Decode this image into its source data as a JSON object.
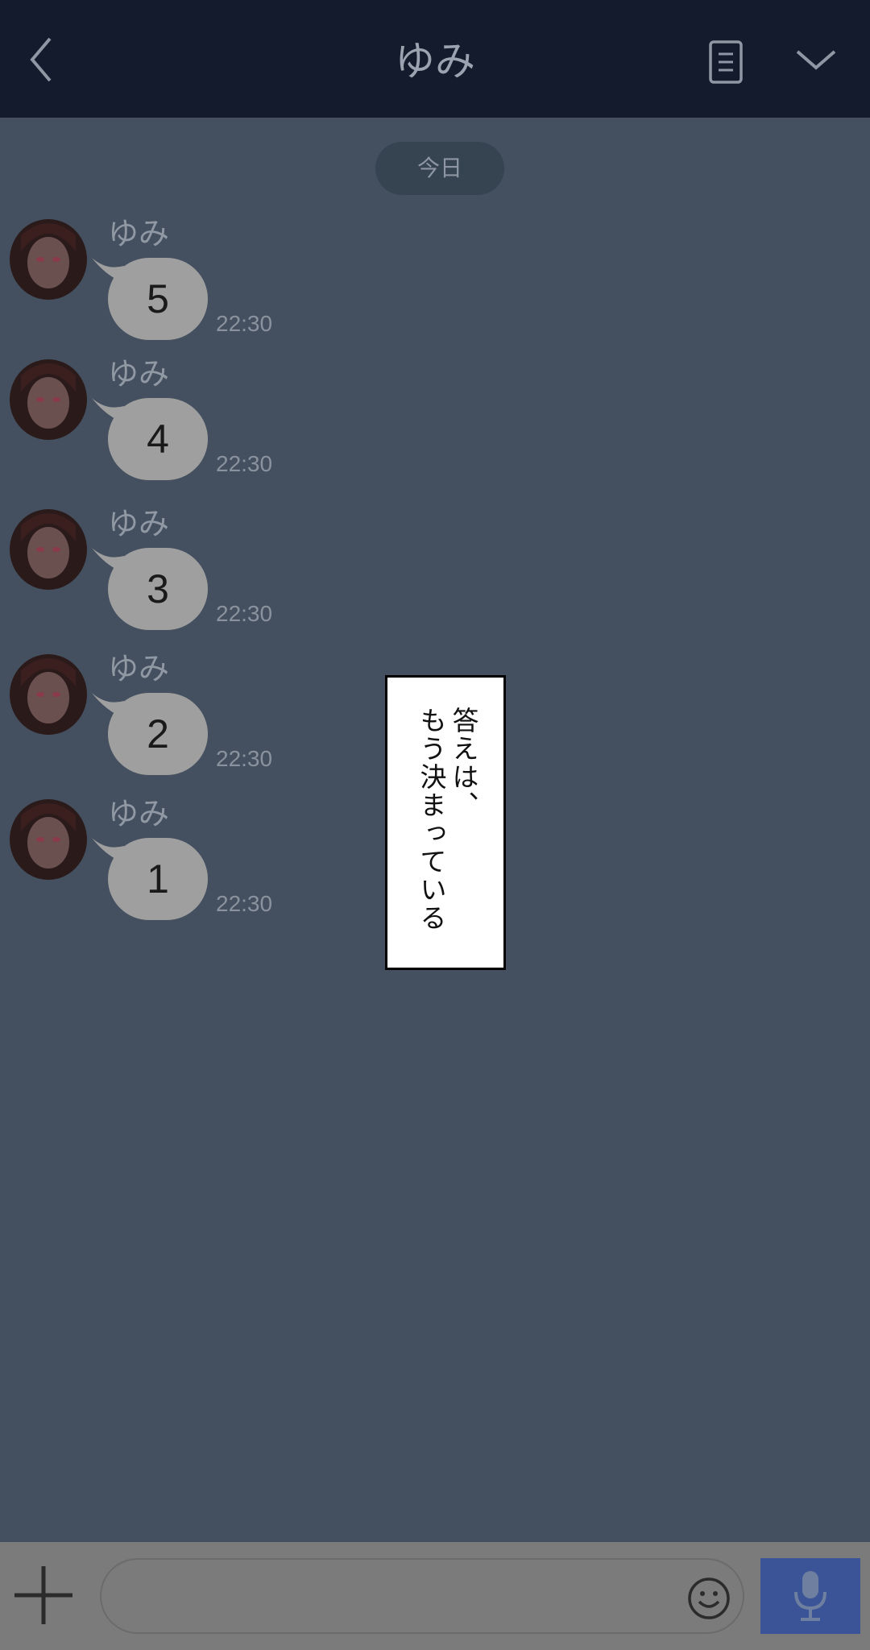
{
  "header": {
    "title": "ゆみ",
    "back_icon": "chevron-left-icon",
    "memo_icon": "note-icon",
    "menu_icon": "chevron-down-icon"
  },
  "date_divider": "今日",
  "messages": [
    {
      "sender": "ゆみ",
      "text": "5",
      "time": "22:30"
    },
    {
      "sender": "ゆみ",
      "text": "4",
      "time": "22:30"
    },
    {
      "sender": "ゆみ",
      "text": "3",
      "time": "22:30"
    },
    {
      "sender": "ゆみ",
      "text": "2",
      "time": "22:30"
    },
    {
      "sender": "ゆみ",
      "text": "1",
      "time": "22:30"
    }
  ],
  "caption": {
    "line1": "答えは、",
    "line2": "もう決まっている"
  },
  "input": {
    "value": "",
    "placeholder": ""
  },
  "icons": {
    "plus": "plus-icon",
    "emoji": "smiley-icon",
    "mic": "microphone-icon"
  },
  "colors": {
    "header_bg": "#131b2c",
    "chat_bg": "#44505f",
    "bubble": "#9f9f9f",
    "footer_bg": "#7b7b7b",
    "mic_button": "#3a5497"
  }
}
